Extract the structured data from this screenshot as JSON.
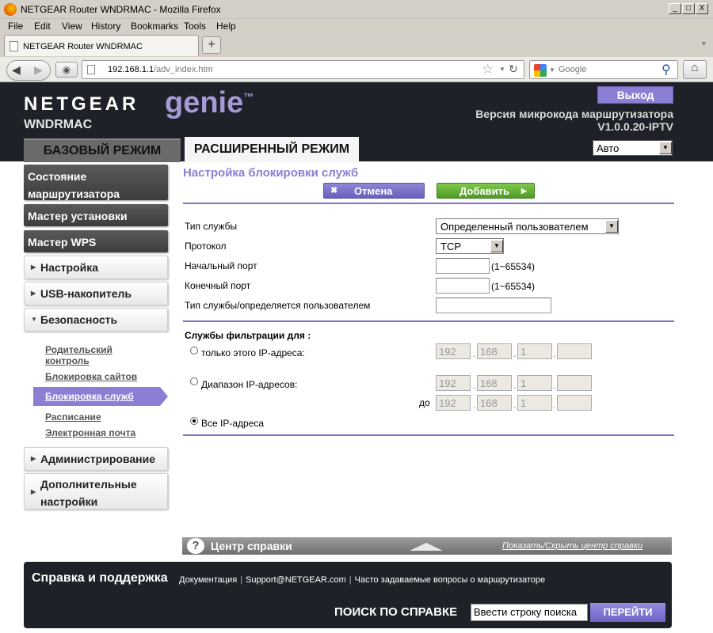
{
  "window": {
    "title": "NETGEAR Router WNDRMAC - Mozilla Firefox",
    "controls": [
      "_",
      "□",
      "X"
    ]
  },
  "menubar": {
    "items": [
      "File",
      "Edit",
      "View",
      "History",
      "Bookmarks",
      "Tools",
      "Help"
    ]
  },
  "browser": {
    "tab_title": "NETGEAR Router WNDRMAC",
    "new_tab": "+",
    "url_host": "192.168.1.1",
    "url_path": "/adv_index.htm",
    "search_placeholder": "Google"
  },
  "header": {
    "brand": "NETGEAR",
    "genie": "genie",
    "tm": "™",
    "model": "WNDRMAC",
    "logout": "Выход",
    "firmware_label": "Версия микрокода маршрутизатора",
    "firmware_version": "V1.0.0.20-IPTV",
    "tab_basic": "БАЗОВЫЙ РЕЖИМ",
    "tab_advanced": "РАСШИРЕННЫЙ РЕЖИМ",
    "language": "Авто"
  },
  "sidebar": {
    "router_status": "Состояние маршрутизатора",
    "setup_wizard": "Мастер установки",
    "wps_wizard": "Мастер WPS",
    "setup": "Настройка",
    "usb_storage": "USB-накопитель",
    "security": "Безопасность",
    "sub": {
      "parental_control": "Родительский контроль",
      "block_sites": "Блокировка сайтов",
      "block_services": "Блокировка служб",
      "schedule": "Расписание",
      "email": "Электронная почта"
    },
    "administration": "Администрирование",
    "advanced_setup": "Дополнительные настройки"
  },
  "main": {
    "title": "Настройка блокировки служб",
    "cancel": "Отмена",
    "add": "Добавить",
    "fields": {
      "service_type_label": "Тип службы",
      "service_type_value": "Определенный пользователем",
      "protocol_label": "Протокол",
      "protocol_value": "TCP",
      "start_port_label": "Начальный порт",
      "start_port_hint": "(1~65534)",
      "end_port_label": "Конечный порт",
      "end_port_hint": "(1~65534)",
      "user_defined_label": "Тип службы/определяется пользователем"
    },
    "filter": {
      "heading": "Службы фильтрации для :",
      "only_ip": "только этого IP-адреса:",
      "ip_range": "Диапазон IP-адресов:",
      "to": "до",
      "all_ip": "Все IP-адреса",
      "single_ip": [
        "192",
        "168",
        "1",
        ""
      ],
      "range_from": [
        "192",
        "168",
        "1",
        ""
      ],
      "range_to": [
        "192",
        "168",
        "1",
        ""
      ],
      "selected": "all_ip"
    }
  },
  "helpbar": {
    "q": "?",
    "title": "Центр справки",
    "toggle": "Показать/Скрыть центр справки"
  },
  "footer": {
    "title": "Справка и поддержка",
    "links": [
      "Документация",
      "Support@NETGEAR.com",
      "Часто задаваемые вопросы о маршрутизаторе"
    ],
    "search_label": "ПОИСК ПО СПРАВКЕ",
    "search_value": "Ввести строку поиска",
    "go": "ПЕРЕЙТИ"
  }
}
